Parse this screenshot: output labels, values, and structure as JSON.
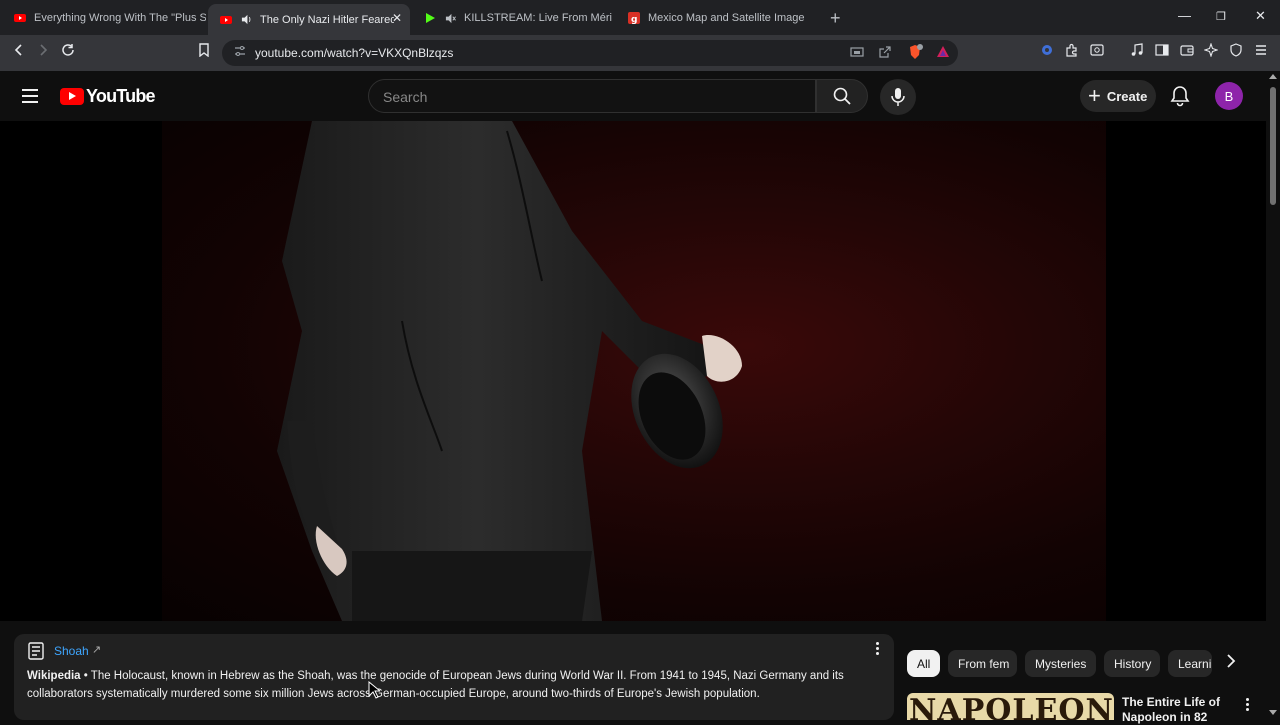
{
  "browser": {
    "tabs": [
      {
        "label": "Everything Wrong With The \"Plus Siz",
        "favicon": "youtube-icon"
      },
      {
        "label": "The Only Nazi Hitler Feared -",
        "favicon": "youtube-icon",
        "audio": "speaker-icon"
      },
      {
        "label": "KILLSTREAM: Live From Mérida, M",
        "favicon": "play-green-icon",
        "audio": "muted-icon"
      },
      {
        "label": "Mexico Map and Satellite Image",
        "favicon": "g-red-icon"
      }
    ],
    "url": "youtube.com/watch?v=VKXQnBlzqzs"
  },
  "youtube": {
    "logo_text": "YouTube",
    "search_placeholder": "Search",
    "create_label": "Create",
    "avatar_letter": "B"
  },
  "info_panel": {
    "topic": "Shoah",
    "source": "Wikipedia",
    "separator": " • ",
    "description": "The Holocaust, known in Hebrew as the Shoah, was the genocide of European Jews during World War II. From 1941 to 1945, Nazi Germany and its collaborators systematically murdered some six million Jews across German-occupied Europe, around two-thirds of Europe's Jewish population."
  },
  "chips": [
    "All",
    "From fem",
    "Mysteries",
    "History",
    "Learni"
  ],
  "recommendation": {
    "thumb_text": "NAPOLEON",
    "title": "The Entire Life of Napoleon in 82"
  },
  "colors": {
    "accent_red": "#ff0000",
    "link_blue": "#3ea6ff",
    "avatar_purple": "#8e24aa"
  }
}
